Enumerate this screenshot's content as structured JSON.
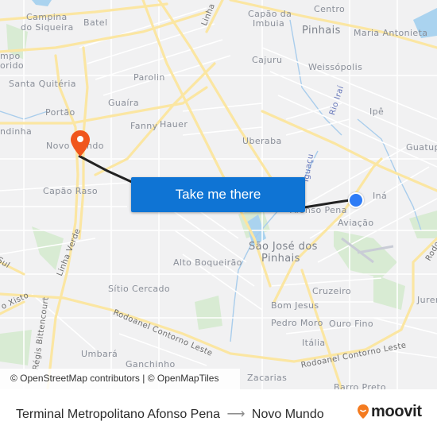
{
  "map": {
    "labels": [
      {
        "text": "Campina",
        "name": "label-campina"
      },
      {
        "text": "do Siqueira",
        "name": "label-do-siqueira"
      },
      {
        "text": "Batel",
        "name": "label-batel"
      },
      {
        "text": "Capão da",
        "name": "label-capao-da"
      },
      {
        "text": "Imbuia",
        "name": "label-imbuia"
      },
      {
        "text": "Centro",
        "name": "label-centro"
      },
      {
        "text": "Pinhais",
        "name": "label-pinhais"
      },
      {
        "text": "Maria Antonieta",
        "name": "label-maria-antonieta"
      },
      {
        "text": "mpo",
        "name": "label-campo-partial"
      },
      {
        "text": "orido",
        "name": "label-florido-partial"
      },
      {
        "text": "Cajuru",
        "name": "label-cajuru"
      },
      {
        "text": "Weissópolis",
        "name": "label-weissopolis"
      },
      {
        "text": "Santa Quitéria",
        "name": "label-santa-quiteria"
      },
      {
        "text": "Parolin",
        "name": "label-parolin"
      },
      {
        "text": "Guaíra",
        "name": "label-guaira"
      },
      {
        "text": "Portão",
        "name": "label-portao"
      },
      {
        "text": "Ipê",
        "name": "label-ipe"
      },
      {
        "text": "ndinha",
        "name": "label-lindinha-partial"
      },
      {
        "text": "Fanny",
        "name": "label-fanny"
      },
      {
        "text": "Hauer",
        "name": "label-hauer"
      },
      {
        "text": "Uberaba",
        "name": "label-uberaba"
      },
      {
        "text": "Guatup",
        "name": "label-guatupe-partial"
      },
      {
        "text": "Novo Mundo",
        "name": "label-novo-mundo"
      },
      {
        "text": "Capão Raso",
        "name": "label-capao-raso"
      },
      {
        "text": "Iná",
        "name": "label-ina"
      },
      {
        "text": "Afonso Pena",
        "name": "label-afonso-pena"
      },
      {
        "text": "Aviação",
        "name": "label-aviacao"
      },
      {
        "text": "São José dos",
        "name": "label-sao-jose-dos"
      },
      {
        "text": "Pinhais",
        "name": "label-sjp-pinhais"
      },
      {
        "text": "Alto Boqueirão",
        "name": "label-alto-boqueirao"
      },
      {
        "text": "Sítio Cercado",
        "name": "label-sitio-cercado"
      },
      {
        "text": "Cruzeiro",
        "name": "label-cruzeiro"
      },
      {
        "text": "Jurer",
        "name": "label-jurere-partial"
      },
      {
        "text": "Bom Jesus",
        "name": "label-bom-jesus"
      },
      {
        "text": "Pedro Moro",
        "name": "label-pedro-moro"
      },
      {
        "text": "Ouro Fino",
        "name": "label-ouro-fino"
      },
      {
        "text": "Itália",
        "name": "label-italia"
      },
      {
        "text": "Umbará",
        "name": "label-umbara"
      },
      {
        "text": "Ganchinho",
        "name": "label-ganchinho"
      },
      {
        "text": "Zacarias",
        "name": "label-zacarias"
      },
      {
        "text": "Barro Preto",
        "name": "label-barro-preto"
      }
    ],
    "roads": {
      "linha_verde_north": "Linha Verde",
      "linha_verde_south": "Linha Verde",
      "rodoanel_west": "Rodoanel Contorno Leste",
      "rodoanel_east": "Rodoanel Contorno Leste",
      "xisto": "o Xisto",
      "sul": "Sul",
      "bittencourt": "Régis Bittencourt",
      "rodo_partial": "Rodo"
    },
    "rivers": {
      "irai": "Rio Iraí",
      "iguacu": "Iguaçu"
    },
    "attribution": "© OpenStreetMap contributors | © OpenMapTiles",
    "cta_button": "Take me there",
    "colors": {
      "background": "#f1f1f2",
      "major_road": "#fbe6a2",
      "minor_road": "#ffffff",
      "water": "#a9d3f0",
      "park": "#d4ead0",
      "route_line": "#222222",
      "origin_marker": "#2e7cf6",
      "destination_marker": "#f0561d",
      "button": "#0f74d4"
    }
  },
  "footer": {
    "origin": "Terminal Metropolitano Afonso Pena",
    "arrow": "⟶",
    "destination": "Novo Mundo",
    "brand": "moovit",
    "brand_color": "#f47b20"
  }
}
